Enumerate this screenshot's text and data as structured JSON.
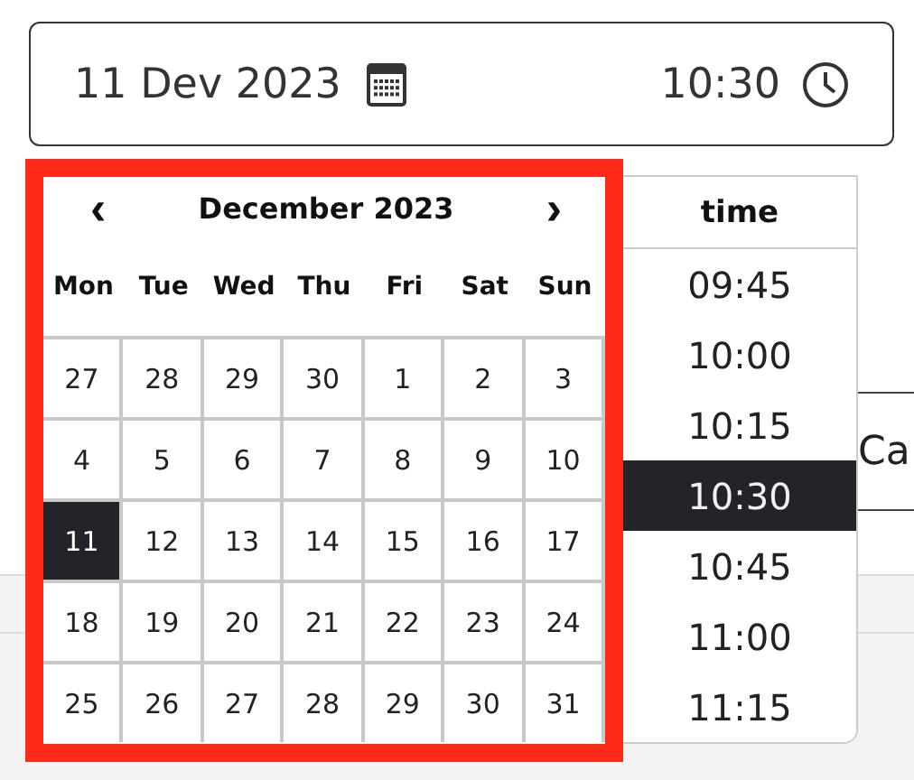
{
  "date_field": {
    "date": "11 Dev 2023",
    "time": "10:30"
  },
  "calendar": {
    "month": "December 2023",
    "prev": "‹",
    "next": "›",
    "weekdays": [
      "Mon",
      "Tue",
      "Wed",
      "Thu",
      "Fri",
      "Sat",
      "Sun"
    ],
    "weeks": [
      [
        {
          "day": "27",
          "selected": false
        },
        {
          "day": "28",
          "selected": false
        },
        {
          "day": "29",
          "selected": false
        },
        {
          "day": "30",
          "selected": false
        },
        {
          "day": "1",
          "selected": false
        },
        {
          "day": "2",
          "selected": false
        },
        {
          "day": "3",
          "selected": false
        }
      ],
      [
        {
          "day": "4",
          "selected": false
        },
        {
          "day": "5",
          "selected": false
        },
        {
          "day": "6",
          "selected": false
        },
        {
          "day": "7",
          "selected": false
        },
        {
          "day": "8",
          "selected": false
        },
        {
          "day": "9",
          "selected": false
        },
        {
          "day": "10",
          "selected": false
        }
      ],
      [
        {
          "day": "11",
          "selected": true
        },
        {
          "day": "12",
          "selected": false
        },
        {
          "day": "13",
          "selected": false
        },
        {
          "day": "14",
          "selected": false
        },
        {
          "day": "15",
          "selected": false
        },
        {
          "day": "16",
          "selected": false
        },
        {
          "day": "17",
          "selected": false
        }
      ],
      [
        {
          "day": "18",
          "selected": false
        },
        {
          "day": "19",
          "selected": false
        },
        {
          "day": "20",
          "selected": false
        },
        {
          "day": "21",
          "selected": false
        },
        {
          "day": "22",
          "selected": false
        },
        {
          "day": "23",
          "selected": false
        },
        {
          "day": "24",
          "selected": false
        }
      ],
      [
        {
          "day": "25",
          "selected": false
        },
        {
          "day": "26",
          "selected": false
        },
        {
          "day": "27",
          "selected": false
        },
        {
          "day": "28",
          "selected": false
        },
        {
          "day": "29",
          "selected": false
        },
        {
          "day": "30",
          "selected": false
        },
        {
          "day": "31",
          "selected": false
        }
      ]
    ]
  },
  "time_list": {
    "header": "time",
    "times": [
      {
        "label": "09:45",
        "selected": false
      },
      {
        "label": "10:00",
        "selected": false
      },
      {
        "label": "10:15",
        "selected": false
      },
      {
        "label": "10:30",
        "selected": true
      },
      {
        "label": "10:45",
        "selected": false
      },
      {
        "label": "11:00",
        "selected": false
      },
      {
        "label": "11:15",
        "selected": false
      }
    ]
  },
  "background_button": "Ca"
}
